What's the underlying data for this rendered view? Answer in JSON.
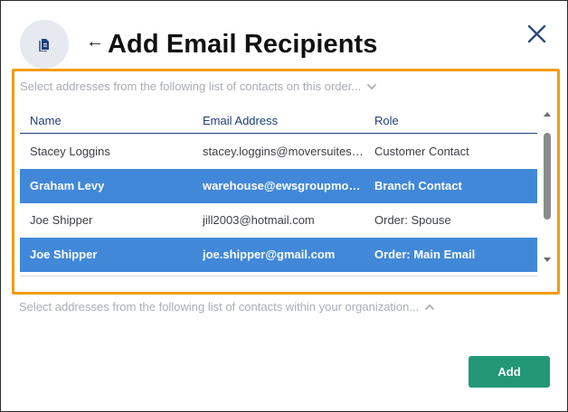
{
  "dialog": {
    "title": "Add Email Recipients",
    "back_glyph": "←",
    "icons": {
      "header": "document-icon",
      "close": "close-icon"
    }
  },
  "contacts_section": {
    "label": "Select addresses from the following list of contacts on this order...",
    "expanded": true,
    "columns": [
      "Name",
      "Email Address",
      "Role"
    ],
    "rows": [
      {
        "name": "Stacey Loggins",
        "email": "stacey.loggins@moversuites.com",
        "role": "Customer Contact",
        "selected": false
      },
      {
        "name": "Graham Levy",
        "email": "warehouse@ewsgroupmoving.com",
        "role": "Branch Contact",
        "selected": true
      },
      {
        "name": "Joe Shipper",
        "email": "jill2003@hotmail.com",
        "role": "Order: Spouse",
        "selected": false
      },
      {
        "name": "Joe Shipper",
        "email": "joe.shipper@gmail.com",
        "role": "Order: Main Email",
        "selected": true
      }
    ]
  },
  "org_section": {
    "label": "Select addresses from the following list of contacts within your organization...",
    "expanded": false
  },
  "footer": {
    "add_label": "Add"
  },
  "colors": {
    "accent_border": "#f29c11",
    "selected_row": "#4188d8",
    "header_text": "#1e3f7a",
    "add_button": "#229877"
  }
}
